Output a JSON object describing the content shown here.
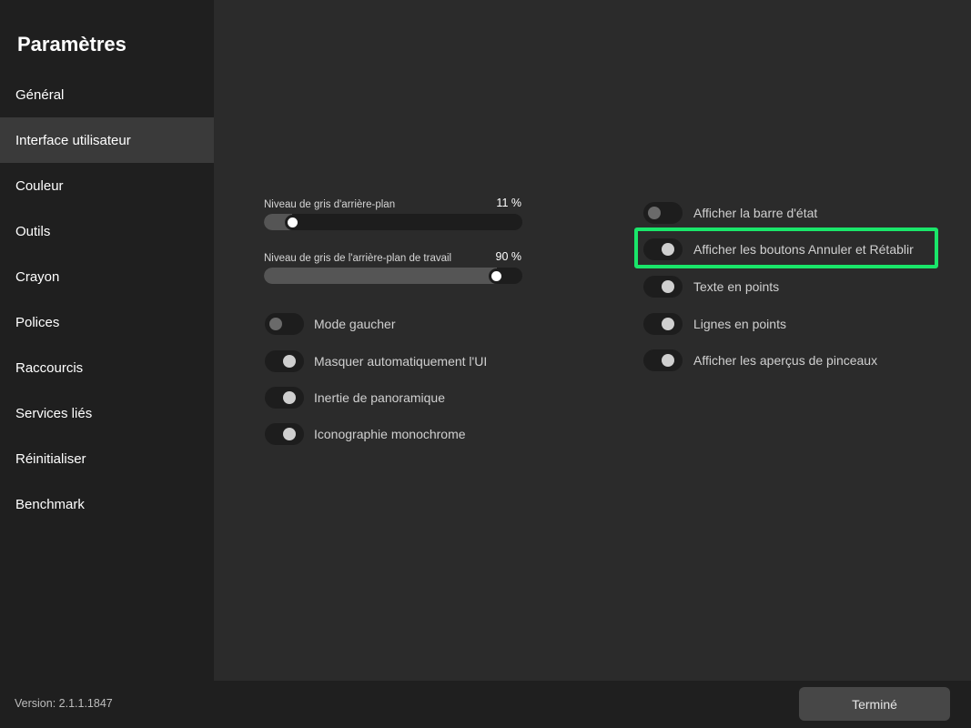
{
  "sidebar": {
    "title": "Paramètres",
    "items": [
      {
        "label": "Général"
      },
      {
        "label": "Interface utilisateur"
      },
      {
        "label": "Couleur"
      },
      {
        "label": "Outils"
      },
      {
        "label": "Crayon"
      },
      {
        "label": "Polices"
      },
      {
        "label": "Raccourcis"
      },
      {
        "label": "Services liés"
      },
      {
        "label": "Réinitialiser"
      },
      {
        "label": "Benchmark"
      }
    ],
    "active_item": "Interface utilisateur"
  },
  "sliders": [
    {
      "label": "Niveau de gris d'arrière-plan",
      "value": "11 %",
      "level_percent": 11
    },
    {
      "label": "Niveau de gris de l'arrière-plan de travail",
      "value": "90 %",
      "level_percent": 90
    }
  ],
  "left_toggles": [
    {
      "label": "Mode gaucher",
      "state": "off"
    },
    {
      "label": "Masquer automatiquement l'UI",
      "state": "on"
    },
    {
      "label": "Inertie de panoramique",
      "state": "on"
    },
    {
      "label": "Iconographie monochrome",
      "state": "on"
    }
  ],
  "right_toggles": [
    {
      "label": "Afficher la barre d'état",
      "state": "off"
    },
    {
      "label": "Afficher les boutons Annuler et Rétablir",
      "state": "on"
    },
    {
      "label": "Texte en points",
      "state": "on"
    },
    {
      "label": "Lignes en points",
      "state": "on"
    },
    {
      "label": "Afficher les aperçus de pinceaux",
      "state": "on"
    }
  ],
  "footer": {
    "version": "Version: 2.1.1.1847",
    "done_label": "Terminé"
  },
  "colors": {
    "highlight": "#1ae66a",
    "sidebar_bg": "#1f1f1f",
    "main_bg": "#2b2b2b"
  }
}
